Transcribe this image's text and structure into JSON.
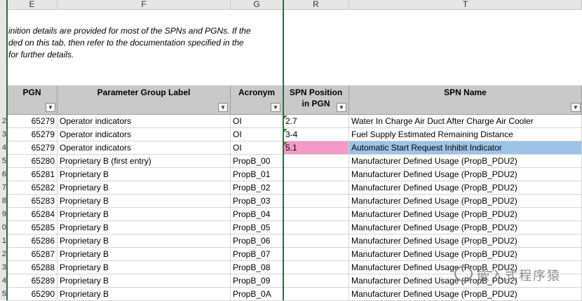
{
  "columns": [
    "E",
    "F",
    "G",
    "R",
    "T"
  ],
  "note_lines": [
    "inition details are provided for most of the SPNs and PGNs.  If the",
    "ded on this tab, then refer to the documentation specified in the",
    "for further details."
  ],
  "headers": {
    "pgn": "PGN",
    "label": "Parameter Group Label",
    "acronym": "Acronym",
    "spn_pos_1": "SPN Position",
    "spn_pos_2": "in PGN",
    "spn_name": "SPN Name"
  },
  "row_numbers": [
    "2",
    "3",
    "4",
    "5",
    "6",
    "7",
    "8",
    "9",
    "0",
    "1",
    "2",
    "3",
    "4",
    "5"
  ],
  "rows": [
    {
      "pgn": "65279",
      "label": "Operator indicators",
      "acronym": "OI",
      "pos": "2.7",
      "name": "Water In Charge Air Duct After Charge Air Cooler"
    },
    {
      "pgn": "65279",
      "label": "Operator indicators",
      "acronym": "OI",
      "pos": "3-4",
      "name": "Fuel Supply Estimated Remaining Distance"
    },
    {
      "pgn": "65279",
      "label": "Operator indicators",
      "acronym": "OI",
      "pos": "5.1",
      "name": "Automatic Start Request Inhibit Indicator"
    },
    {
      "pgn": "65280",
      "label": "Proprietary B (first entry)",
      "acronym": "PropB_00",
      "pos": "",
      "name": "Manufacturer Defined Usage (PropB_PDU2)"
    },
    {
      "pgn": "65281",
      "label": "Proprietary B",
      "acronym": "PropB_01",
      "pos": "",
      "name": "Manufacturer Defined Usage (PropB_PDU2)"
    },
    {
      "pgn": "65282",
      "label": "Proprietary B",
      "acronym": "PropB_02",
      "pos": "",
      "name": "Manufacturer Defined Usage (PropB_PDU2)"
    },
    {
      "pgn": "65283",
      "label": "Proprietary B",
      "acronym": "PropB_03",
      "pos": "",
      "name": "Manufacturer Defined Usage (PropB_PDU2)"
    },
    {
      "pgn": "65284",
      "label": "Proprietary B",
      "acronym": "PropB_04",
      "pos": "",
      "name": "Manufacturer Defined Usage (PropB_PDU2)"
    },
    {
      "pgn": "65285",
      "label": "Proprietary B",
      "acronym": "PropB_05",
      "pos": "",
      "name": "Manufacturer Defined Usage (PropB_PDU2)"
    },
    {
      "pgn": "65286",
      "label": "Proprietary B",
      "acronym": "PropB_06",
      "pos": "",
      "name": "Manufacturer Defined Usage (PropB_PDU2)"
    },
    {
      "pgn": "65287",
      "label": "Proprietary B",
      "acronym": "PropB_07",
      "pos": "",
      "name": "Manufacturer Defined Usage (PropB_PDU2)"
    },
    {
      "pgn": "65288",
      "label": "Proprietary B",
      "acronym": "PropB_08",
      "pos": "",
      "name": "Manufacturer Defined Usage (PropB_PDU2)"
    },
    {
      "pgn": "65289",
      "label": "Proprietary B",
      "acronym": "PropB_09",
      "pos": "",
      "name": "Manufacturer Defined Usage (PropB_PDU2)"
    },
    {
      "pgn": "65290",
      "label": "Proprietary B",
      "acronym": "PropB_0A",
      "pos": "",
      "name": "Manufacturer Defined Usage (PropB_PDU2)"
    }
  ],
  "highlight": {
    "pos_color": "#f59ac8",
    "name_color": "#9dc3e6",
    "row_index": 2
  },
  "watermark": "嵌入式程序猿",
  "icons": {
    "dropdown": "dropdown-arrow-icon",
    "watermark": "wechat-icon"
  }
}
